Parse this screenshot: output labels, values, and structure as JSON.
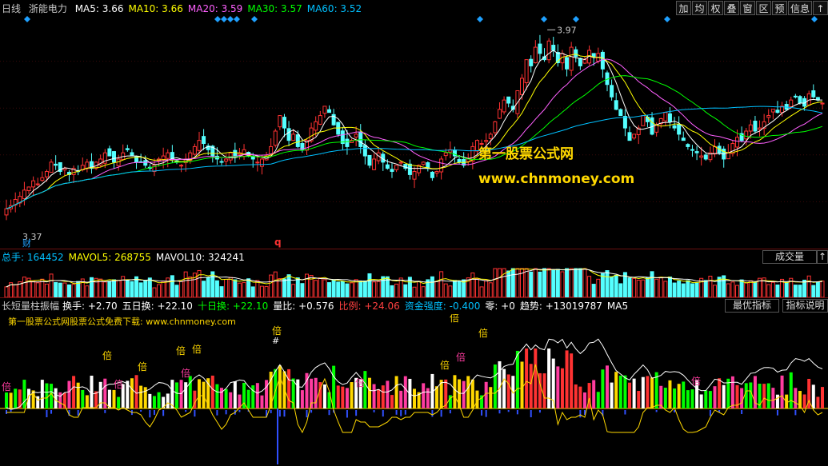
{
  "toolbar": {
    "buttons": [
      "加",
      "均",
      "权",
      "叠",
      "窗",
      "区",
      "预",
      "信息",
      "↑"
    ]
  },
  "main_panel": {
    "period": "日线",
    "stock_name": "浙能电力",
    "ma": [
      {
        "label": "MA5: ",
        "value": "3.66",
        "color": "#ffffff"
      },
      {
        "label": "MA10: ",
        "value": "3.66",
        "color": "#ffff00"
      },
      {
        "label": "MA20: ",
        "value": "3.59",
        "color": "#ff60ff"
      },
      {
        "label": "MA30: ",
        "value": "3.57",
        "color": "#00ff00"
      },
      {
        "label": "MA60: ",
        "value": "3.52",
        "color": "#00c0ff"
      }
    ],
    "high_label": "3.97",
    "low_label": "3.37",
    "cai_marker": "财",
    "q_marker": "q"
  },
  "volume_panel": {
    "items": [
      {
        "label": "总手: ",
        "value": "164452",
        "color": "#00c0ff"
      },
      {
        "label": "MAVOL5: ",
        "value": "268755",
        "color": "#ffff00"
      },
      {
        "label": "MAVOL10: ",
        "value": "324241",
        "color": "#ffffff"
      }
    ],
    "button": "成交量",
    "button_right": "↑"
  },
  "indicator_panel": {
    "name": "长短量柱振幅",
    "items": [
      {
        "label": "换手: ",
        "value": "+2.70",
        "color": "#ffffff"
      },
      {
        "label": "五日换: ",
        "value": "+22.10",
        "color": "#ffffff"
      },
      {
        "label": "十日换: ",
        "value": "+22.10",
        "color": "#00ff00"
      },
      {
        "label": "量比: ",
        "value": "+0.576",
        "color": "#ffffff"
      },
      {
        "label": "比例: ",
        "value": "+24.06",
        "color": "#ff4040"
      },
      {
        "label": "资金强度: ",
        "value": "-0.400",
        "color": "#00c0ff"
      },
      {
        "label": "零: ",
        "value": "+0",
        "color": "#ffffff"
      },
      {
        "label": "趋势: ",
        "value": "+13019787",
        "color": "#ffffff"
      },
      {
        "label": "MA5",
        "value": "",
        "color": "#ffffff"
      }
    ],
    "btn_best": "最优指标",
    "btn_explain": "指标说明",
    "ad_text": "第一股票公式网股票公式免费下载: www.chnmoney.com",
    "bei": "倍",
    "hash": "#"
  },
  "watermark": {
    "line1": "第一股票公式网",
    "line2": "www.chnmoney.com"
  },
  "colors": {
    "up": "#ff3232",
    "down": "#54ffff",
    "ma5": "#ffffff",
    "ma10": "#ffff00",
    "ma20": "#ff60ff",
    "ma30": "#00ff00",
    "ma60": "#00c0ff"
  },
  "chart_data": {
    "type": "candlestick",
    "price_range": [
      3.3,
      4.0
    ],
    "closes": [
      3.4,
      3.41,
      3.43,
      3.44,
      3.46,
      3.47,
      3.49,
      3.48,
      3.5,
      3.52,
      3.55,
      3.54,
      3.52,
      3.53,
      3.51,
      3.53,
      3.52,
      3.54,
      3.55,
      3.53,
      3.55,
      3.56,
      3.58,
      3.57,
      3.55,
      3.56,
      3.58,
      3.59,
      3.57,
      3.55,
      3.55,
      3.54,
      3.53,
      3.54,
      3.56,
      3.57,
      3.58,
      3.56,
      3.55,
      3.54,
      3.56,
      3.58,
      3.6,
      3.62,
      3.61,
      3.59,
      3.57,
      3.56,
      3.55,
      3.56,
      3.58,
      3.57,
      3.58,
      3.59,
      3.57,
      3.56,
      3.55,
      3.56,
      3.57,
      3.6,
      3.65,
      3.7,
      3.66,
      3.62,
      3.64,
      3.6,
      3.59,
      3.62,
      3.66,
      3.68,
      3.7,
      3.73,
      3.71,
      3.67,
      3.64,
      3.61,
      3.6,
      3.62,
      3.64,
      3.6,
      3.57,
      3.54,
      3.56,
      3.58,
      3.55,
      3.53,
      3.52,
      3.54,
      3.55,
      3.53,
      3.51,
      3.52,
      3.54,
      3.55,
      3.53,
      3.5,
      3.52,
      3.56,
      3.58,
      3.59,
      3.57,
      3.55,
      3.54,
      3.56,
      3.6,
      3.62,
      3.61,
      3.62,
      3.64,
      3.68,
      3.72,
      3.75,
      3.74,
      3.72,
      3.78,
      3.82,
      3.88,
      3.86,
      3.92,
      3.9,
      3.88,
      3.94,
      3.91,
      3.87,
      3.9,
      3.85,
      3.92,
      3.89,
      3.86,
      3.88,
      3.91,
      3.89,
      3.9,
      3.85,
      3.8,
      3.76,
      3.72,
      3.7,
      3.66,
      3.62,
      3.64,
      3.66,
      3.7,
      3.68,
      3.64,
      3.67,
      3.69,
      3.71,
      3.68,
      3.66,
      3.64,
      3.62,
      3.6,
      3.59,
      3.58,
      3.57,
      3.56,
      3.58,
      3.6,
      3.58,
      3.56,
      3.58,
      3.61,
      3.63,
      3.62,
      3.65,
      3.67,
      3.65,
      3.66,
      3.68,
      3.7,
      3.72,
      3.71,
      3.73,
      3.72,
      3.75,
      3.76,
      3.74,
      3.73,
      3.77,
      3.76,
      3.75,
      3.74
    ]
  }
}
